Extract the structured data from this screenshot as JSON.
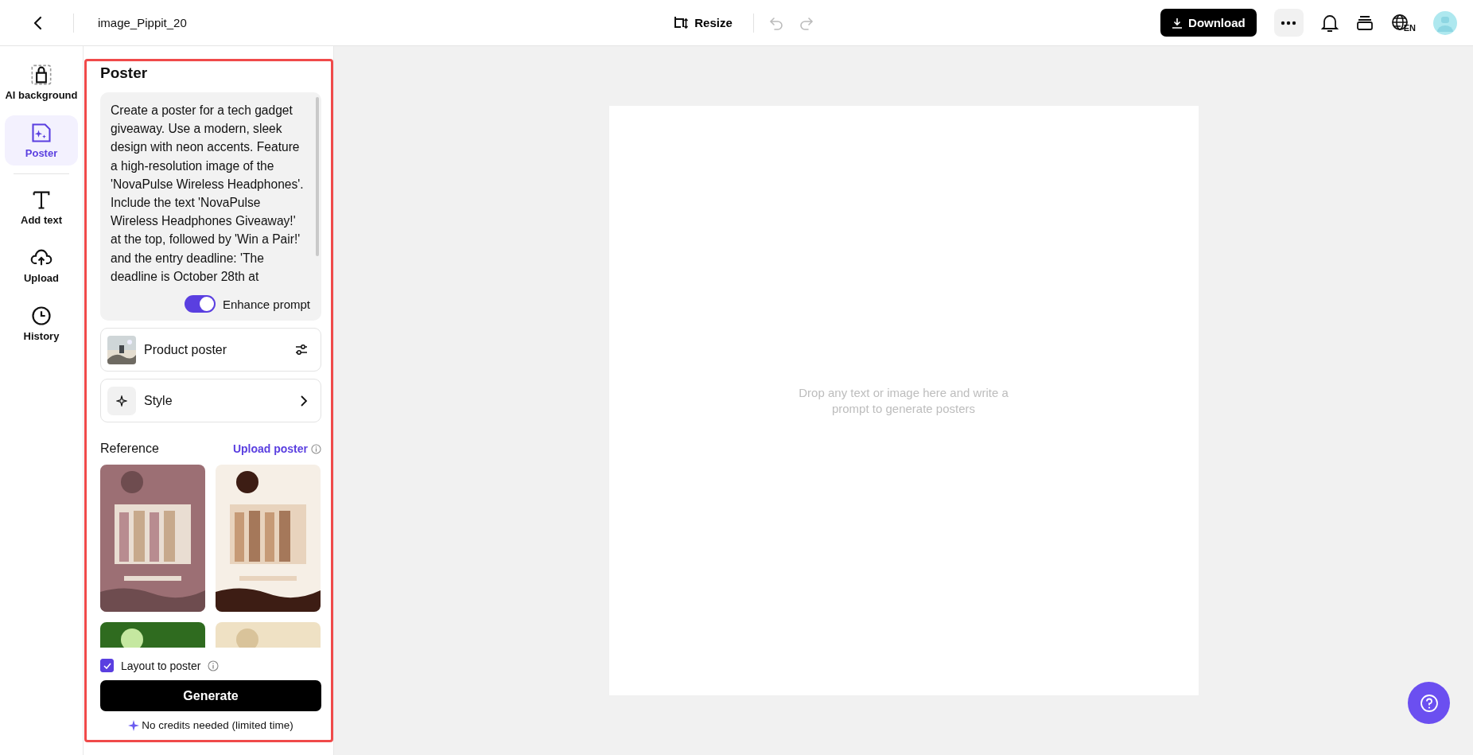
{
  "top_bar": {
    "title": "image_Pippit_20",
    "resize": "Resize",
    "download": "Download",
    "language": "EN"
  },
  "rail": [
    {
      "label": "AI background",
      "kind": "ai",
      "selected": false
    },
    {
      "label": "Poster",
      "kind": "poster",
      "selected": true
    },
    {
      "label": "Add text",
      "kind": "text",
      "selected": false
    },
    {
      "label": "Upload",
      "kind": "upload",
      "selected": false
    },
    {
      "label": "History",
      "kind": "history",
      "selected": false
    }
  ],
  "panel": {
    "title": "Poster",
    "prompt": "Create a poster for a tech gadget giveaway. Use a modern, sleek design with neon accents. Feature a high-resolution image of the 'NovaPulse Wireless Headphones'. Include the text 'NovaPulse Wireless Headphones Giveaway!' at the top, followed by 'Win a Pair!' and the entry deadline: 'The deadline is October 28th at",
    "enhance": {
      "label": "Enhance prompt",
      "on": true
    },
    "product": {
      "label": "Product poster"
    },
    "style": {
      "label": "Style"
    },
    "reference": {
      "title": "Reference",
      "upload": "Upload poster"
    },
    "layout": {
      "label": "Layout to poster",
      "checked": true
    },
    "generate": "Generate",
    "credits": "No credits needed (limited time)"
  },
  "canvas": {
    "placeholder": "Drop any text or image here and write a prompt to generate posters"
  }
}
